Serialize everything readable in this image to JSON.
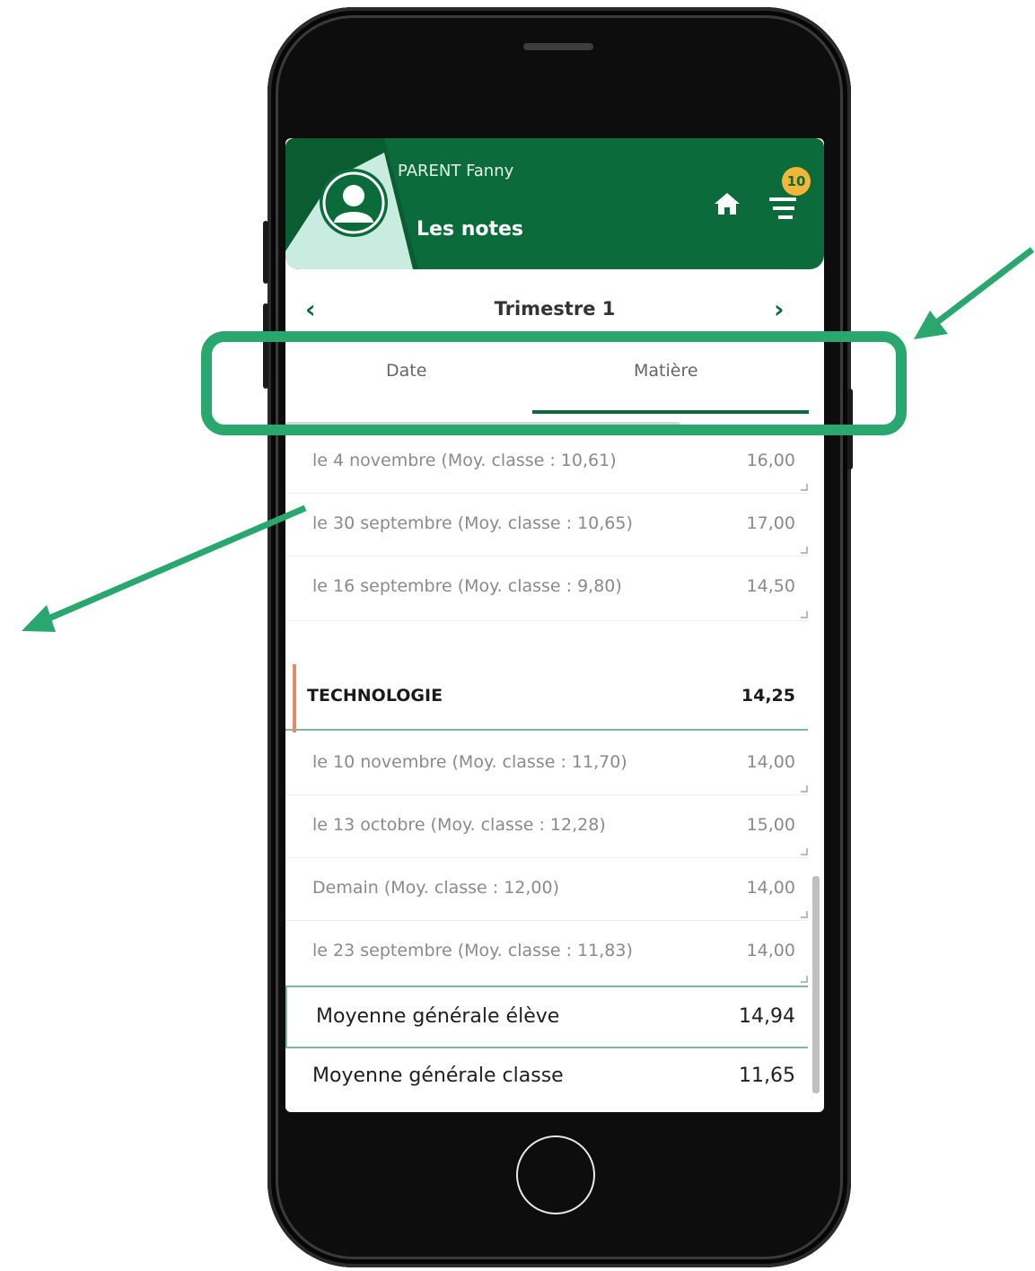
{
  "header": {
    "user_name": "PARENT Fanny",
    "page_title": "Les notes",
    "notification_count": "10",
    "colors": {
      "primary": "#0b6b3a",
      "light": "#c9ece0",
      "badge": "#f2b63b"
    }
  },
  "period": {
    "label": "Trimestre 1",
    "prev": "‹",
    "next": "›"
  },
  "tabs": [
    {
      "label": "Date",
      "active": false
    },
    {
      "label": "Matière",
      "active": true
    }
  ],
  "grades": {
    "rows": [
      {
        "label": "le 4 novembre (Moy. classe : 10,61)",
        "value": "16,00"
      },
      {
        "label": "le 30 septembre (Moy. classe : 10,65)",
        "value": "17,00"
      },
      {
        "label": "le 16 septembre (Moy. classe : 9,80)",
        "value": "14,50"
      }
    ],
    "subject": {
      "label": "TECHNOLOGIE",
      "value": "14,25"
    },
    "subject_rows": [
      {
        "label": "le 10 novembre (Moy. classe : 11,70)",
        "value": "14,00"
      },
      {
        "label": "le 13 octobre (Moy. classe : 12,28)",
        "value": "15,00"
      },
      {
        "label": "Demain (Moy. classe : 12,00)",
        "value": "14,00"
      },
      {
        "label": "le 23 septembre (Moy. classe : 11,83)",
        "value": "14,00"
      }
    ]
  },
  "averages": {
    "student_label": "Moyenne générale élève",
    "student_value": "14,94",
    "class_label": "Moyenne générale classe",
    "class_value": "11,65"
  }
}
